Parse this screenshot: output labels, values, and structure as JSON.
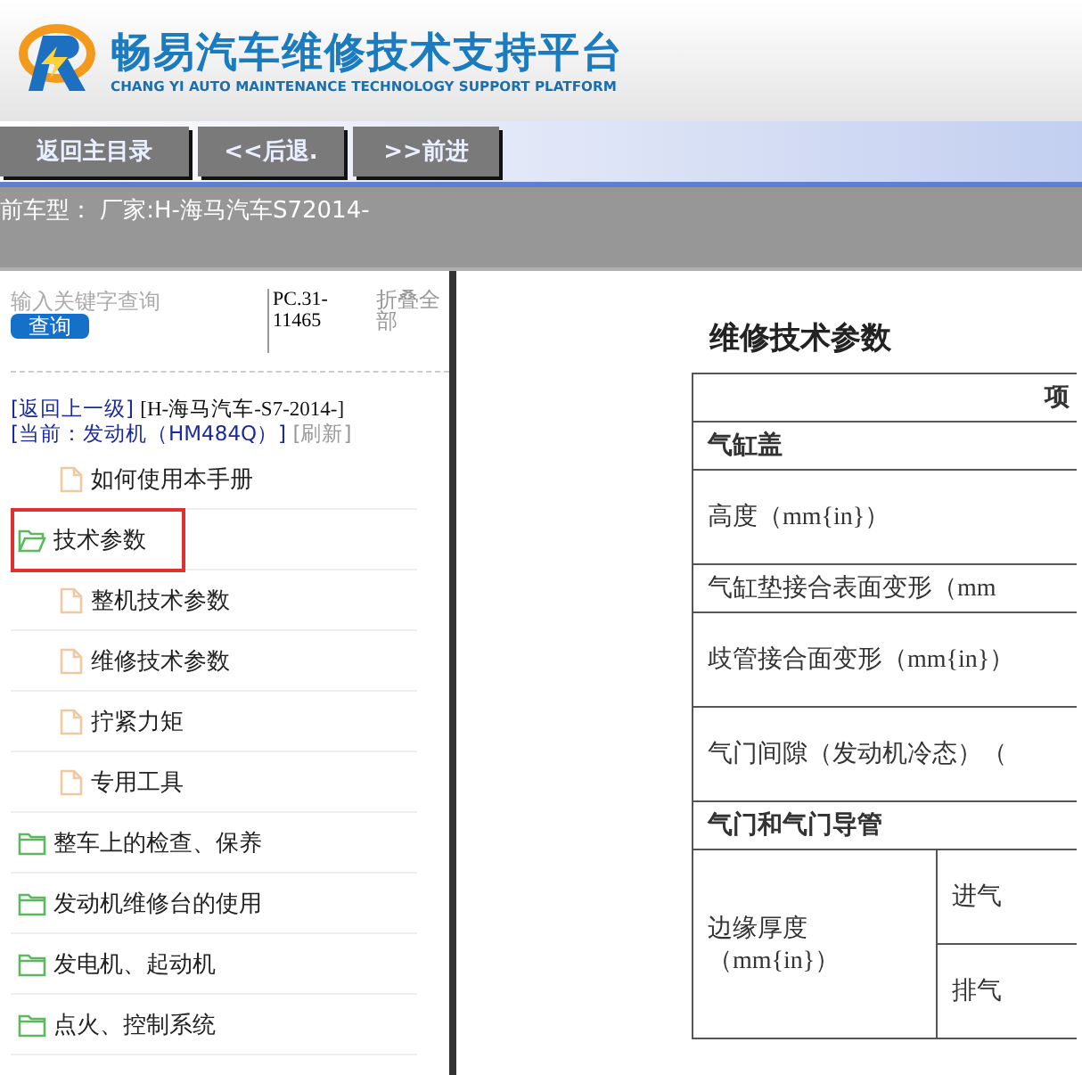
{
  "header": {
    "title": "畅易汽车维修技术支持平台",
    "subtitle": "CHANG YI AUTO MAINTENANCE TECHNOLOGY SUPPORT PLATFORM"
  },
  "nav_buttons": [
    "返回主目录",
    "<<后退.",
    ">>前进"
  ],
  "model_bar": "前车型： 厂家:H-海马汽车S72014-",
  "sidebar": {
    "search": {
      "placeholder": "输入关键字查询"
    },
    "search_button": "查询",
    "code": "PC.31-11465",
    "collapse_all": "折叠全部",
    "back_link": "[返回上一级]",
    "vehicle": "[H-海马汽车-S7-2014-]",
    "current": "[当前：发动机（HM484Q）]",
    "refresh": "[刷新]",
    "tree": [
      {
        "kind": "file",
        "label": "如何使用本手册",
        "selected": false
      },
      {
        "kind": "folder",
        "label": "技术参数",
        "selected": true,
        "expanded": true,
        "children": [
          {
            "kind": "file",
            "label": "整机技术参数",
            "selected": false
          },
          {
            "kind": "file",
            "label": "维修技术参数",
            "selected": false
          },
          {
            "kind": "file",
            "label": "拧紧力矩",
            "selected": false
          },
          {
            "kind": "file",
            "label": "专用工具",
            "selected": false
          }
        ]
      },
      {
        "kind": "folder",
        "label": "整车上的检查、保养",
        "selected": false,
        "expanded": false
      },
      {
        "kind": "folder",
        "label": "发动机维修台的使用",
        "selected": false,
        "expanded": false
      },
      {
        "kind": "folder",
        "label": "发电机、起动机",
        "selected": false,
        "expanded": false
      },
      {
        "kind": "folder",
        "label": "点火、控制系统",
        "selected": false,
        "expanded": false
      }
    ]
  },
  "document": {
    "title": "维修技术参数",
    "table": {
      "header": "项",
      "rows": [
        {
          "kind": "section",
          "cells": [
            {
              "text": "气缸盖",
              "colspan": 2
            }
          ]
        },
        {
          "kind": "tall",
          "cells": [
            {
              "text": "高度（mm{in}）",
              "colspan": 2
            }
          ]
        },
        {
          "kind": "short",
          "cells": [
            {
              "text": "气缸垫接合表面变形（mm",
              "colspan": 2
            }
          ]
        },
        {
          "kind": "tall",
          "cells": [
            {
              "text": "歧管接合面变形（mm{in}）",
              "colspan": 2
            }
          ]
        },
        {
          "kind": "tall",
          "cells": [
            {
              "text": "气门间隙（发动机冷态）（",
              "colspan": 2
            }
          ]
        },
        {
          "kind": "section",
          "cells": [
            {
              "text": "气门和气门导管",
              "colspan": 2
            }
          ]
        },
        {
          "kind": "tall",
          "cells": [
            {
              "text": "边缘厚度（mm{in}）",
              "rowspan": 2
            },
            {
              "text": "进气"
            }
          ]
        },
        {
          "kind": "tall",
          "cells": [
            {
              "text": "排气"
            }
          ]
        }
      ]
    }
  }
}
